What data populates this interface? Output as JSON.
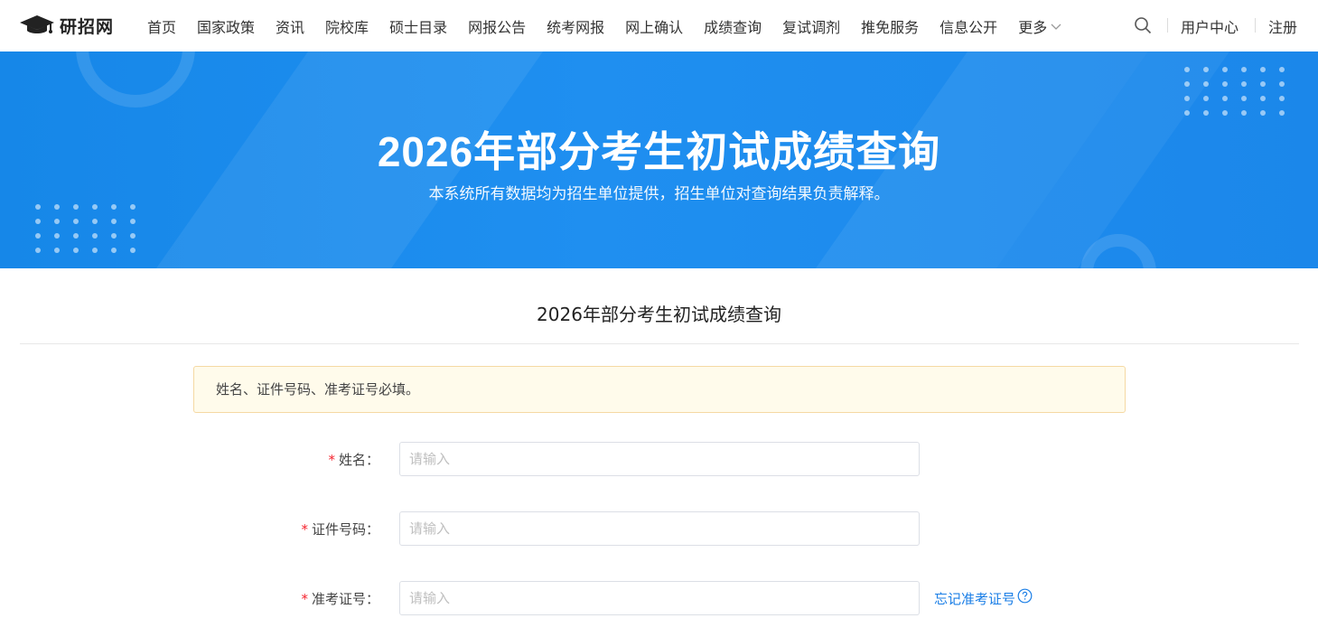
{
  "header": {
    "logo_text": "研招网",
    "nav": [
      "首页",
      "国家政策",
      "资讯",
      "院校库",
      "硕士目录",
      "网报公告",
      "统考网报",
      "网上确认",
      "成绩查询",
      "复试调剂",
      "推免服务",
      "信息公开"
    ],
    "more_label": "更多",
    "user_center": "用户中心",
    "register": "注册"
  },
  "banner": {
    "title": "2026年部分考生初试成绩查询",
    "subtitle": "本系统所有数据均为招生单位提供，招生单位对查询结果负责解释。"
  },
  "main": {
    "page_title": "2026年部分考生初试成绩查询",
    "notice": "姓名、证件号码、准考证号必填。",
    "form": {
      "required_mark": "*",
      "name_label": "姓名：",
      "name_placeholder": "请输入",
      "id_label": "证件号码：",
      "id_placeholder": "请输入",
      "exam_label": "准考证号：",
      "exam_placeholder": "请输入",
      "forgot_exam_link": "忘记准考证号"
    }
  },
  "colors": {
    "accent": "#1a7ee6",
    "banner": "#1f8ff0",
    "required": "#f5222d",
    "notice_bg": "#fffbeb"
  },
  "icons": [
    "graduation-cap-icon",
    "chevron-down-icon",
    "search-icon",
    "question-circle-icon"
  ]
}
